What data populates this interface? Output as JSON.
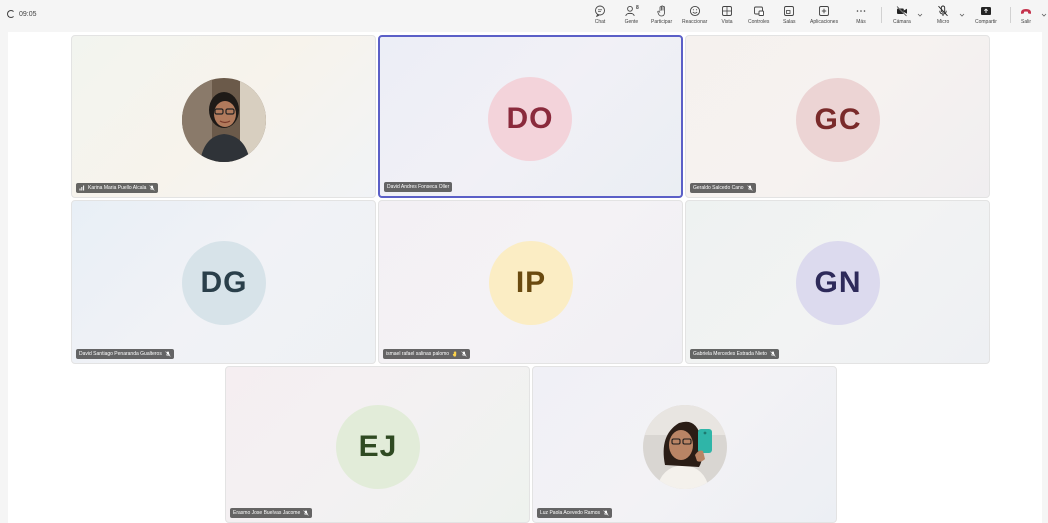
{
  "meeting": {
    "elapsed": "09:05"
  },
  "toolbar": {
    "chat": "Chat",
    "people": "Gente",
    "people_count": "8",
    "raise": "Participar",
    "react": "Reaccionar",
    "view": "Vista",
    "controls": "Controles",
    "rooms": "Salas",
    "apps": "Aplicaciones",
    "more": "Más",
    "camera": "Cámara",
    "mic": "Micro",
    "share": "Compartir",
    "leave": "Salir"
  },
  "participants": [
    {
      "name": "Karina Maria Puello Alcala",
      "initials": "",
      "photo": true,
      "muted": true,
      "active": false
    },
    {
      "name": "David Andres Fonseca Oller",
      "initials": "DO",
      "photo": false,
      "muted": false,
      "active": true
    },
    {
      "name": "Geraldo Salcedo Cano",
      "initials": "GC",
      "photo": false,
      "muted": true,
      "active": false
    },
    {
      "name": "David Santiago Penaranda Gualteros",
      "initials": "DG",
      "photo": false,
      "muted": true,
      "active": false
    },
    {
      "name": "ismael rafael salinas palomo",
      "initials": "IP",
      "photo": false,
      "muted": true,
      "active": false
    },
    {
      "name": "Gabriela Mercedes Estrada Nieto",
      "initials": "GN",
      "photo": false,
      "muted": true,
      "active": false
    },
    {
      "name": "Erasmo Jose Buelvas Jacome",
      "initials": "EJ",
      "photo": false,
      "muted": true,
      "active": false
    },
    {
      "name": "Luz Paola Acevedo Ramos",
      "initials": "",
      "photo": true,
      "muted": true,
      "active": false
    }
  ],
  "colors": {
    "accent": "#5b5fc7",
    "leave": "#c4314b",
    "avatar_DO": "#f3d3da",
    "avatar_GC": "#ecd4d4",
    "avatar_DG": "#d7e3e9",
    "avatar_IP": "#fbedc4",
    "avatar_GN": "#dcdaee",
    "avatar_EJ": "#e2ecd9"
  }
}
